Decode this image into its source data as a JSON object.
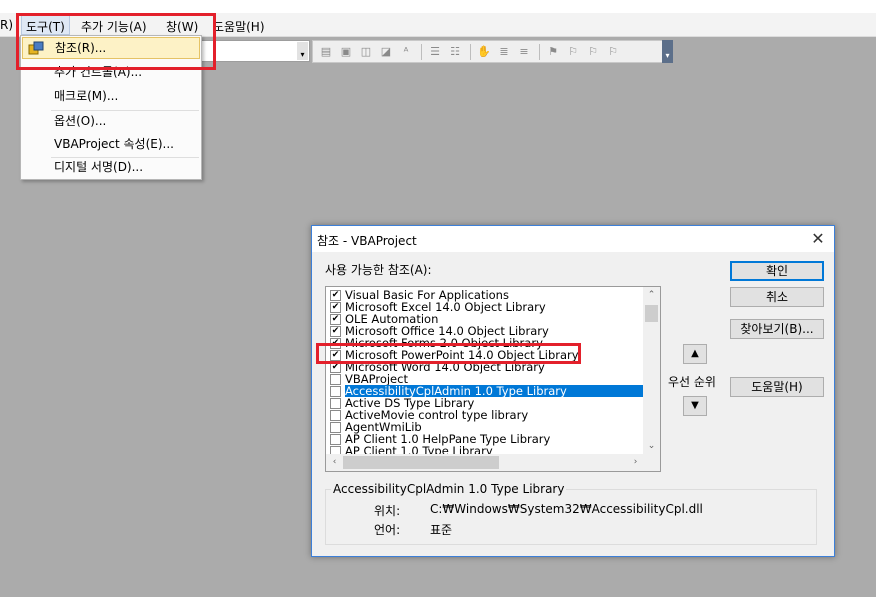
{
  "menubar": {
    "items": [
      "R)",
      "도구(T)",
      "추가 기능(A)",
      "창(W)",
      "도움말(H)"
    ]
  },
  "tools_menu": {
    "items": [
      "참조(R)...",
      "추가 컨트롤(A)...",
      "매크로(M)...",
      "옵션(O)...",
      "VBAProject 속성(E)...",
      "디지털 서명(D)..."
    ]
  },
  "dialog": {
    "title": "참조 - VBAProject",
    "close_glyph": "✕",
    "available_label": "사용 가능한 참조(A):",
    "references": [
      {
        "name": "Visual Basic For Applications",
        "checked": true
      },
      {
        "name": "Microsoft Excel 14.0 Object Library",
        "checked": true
      },
      {
        "name": "OLE Automation",
        "checked": true
      },
      {
        "name": "Microsoft Office 14.0 Object Library",
        "checked": true
      },
      {
        "name": "Microsoft Forms 2.0 Object Library",
        "checked": true
      },
      {
        "name": "Microsoft PowerPoint 14.0 Object Library",
        "checked": true
      },
      {
        "name": "Microsoft Word 14.0 Object Library",
        "checked": true
      },
      {
        "name": "VBAProject",
        "checked": false
      },
      {
        "name": "AccessibilityCplAdmin 1.0 Type Library",
        "checked": false,
        "selected": true
      },
      {
        "name": "Active DS Type Library",
        "checked": false
      },
      {
        "name": "ActiveMovie control type library",
        "checked": false
      },
      {
        "name": "AgentWmiLib",
        "checked": false
      },
      {
        "name": "AP Client 1.0 HelpPane Type Library",
        "checked": false
      },
      {
        "name": "AP Client 1.0 Type Library",
        "checked": false
      }
    ],
    "buttons": {
      "ok": "확인",
      "cancel": "취소",
      "browse": "찾아보기(B)...",
      "help": "도움말(H)"
    },
    "priority_label": "우선 순위",
    "group": {
      "title": "AccessibilityCplAdmin 1.0 Type Library",
      "location_label": "위치:",
      "location_value": "C:₩Windows₩System32₩AccessibilityCpl.dll",
      "language_label": "언어:",
      "language_value": "표준"
    }
  },
  "colors": {
    "highlight_red": "#e3202b",
    "selection_blue": "#0078d7",
    "menu_hover": "#fdf2c6"
  }
}
